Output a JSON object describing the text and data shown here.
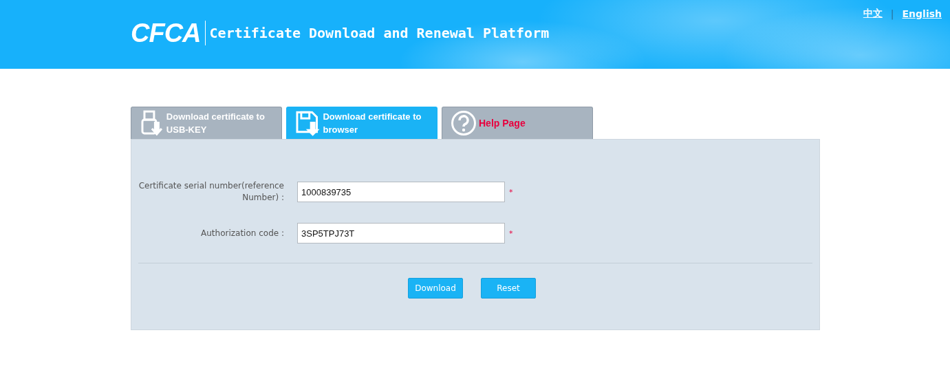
{
  "header": {
    "logo": "CFCA",
    "title": "Certificate Download and Renewal Platform",
    "languages": [
      {
        "label": "中文"
      },
      {
        "label": "English"
      }
    ],
    "separator": "|"
  },
  "tabs": [
    {
      "kind": "usb",
      "label": "Download certificate to USB-KEY",
      "selected": false
    },
    {
      "kind": "floppy",
      "label": "Download certificate to browser",
      "selected": true
    },
    {
      "kind": "help",
      "label": "Help Page",
      "selected": false
    }
  ],
  "form": {
    "fields": [
      {
        "label": "Certificate serial number(reference Number) :",
        "value": "1000839735",
        "required_mark": "*"
      },
      {
        "label": "Authorization code :",
        "value": "3SP5TPJ73T",
        "required_mark": "*"
      }
    ],
    "buttons": [
      "Download",
      "Reset"
    ]
  }
}
